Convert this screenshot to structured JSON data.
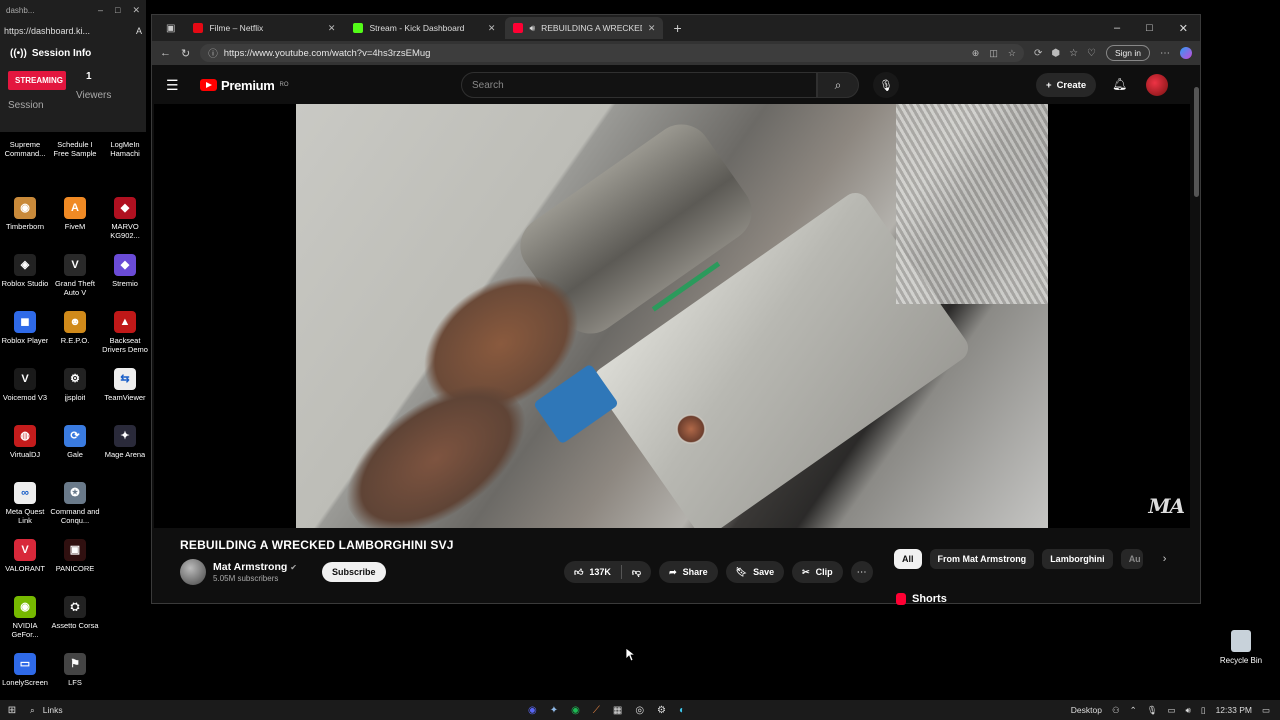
{
  "session_panel": {
    "window_title": "dashb...",
    "url": "https://dashboard.ki...",
    "title": "Session Info",
    "status_badge": "STREAMING",
    "session_label": "Session",
    "viewers_count": "1",
    "viewers_label": "Viewers"
  },
  "desktop_icons": [
    {
      "label": "Supreme Command...",
      "color": "#333"
    },
    {
      "label": "Schedule I Free Sample",
      "color": "#333"
    },
    {
      "label": "LogMeIn Hamachi",
      "color": "#333"
    },
    {
      "label": "Timberborn",
      "color": "#c98a3a",
      "glyph": "◉"
    },
    {
      "label": "FiveM",
      "color": "#f08a24",
      "glyph": "A"
    },
    {
      "label": "MARVO KG902...",
      "color": "#b01020",
      "glyph": "◆"
    },
    {
      "label": "Roblox Studio",
      "color": "#222",
      "glyph": "◈"
    },
    {
      "label": "Grand Theft Auto V",
      "color": "#2a2a2a",
      "glyph": "V"
    },
    {
      "label": "Stremio",
      "color": "#6a4bd6",
      "glyph": "◆"
    },
    {
      "label": "Roblox Player",
      "color": "#2f6ae8",
      "glyph": "◼"
    },
    {
      "label": "R.E.P.O.",
      "color": "#d08a1a",
      "glyph": "☻"
    },
    {
      "label": "Backseat Drivers Demo",
      "color": "#c01818",
      "glyph": "▲"
    },
    {
      "label": "Voicemod V3",
      "color": "#1a1a1a",
      "glyph": "V"
    },
    {
      "label": "jjsploit",
      "color": "#222",
      "glyph": "⚙"
    },
    {
      "label": "TeamViewer",
      "color": "#eeeeee",
      "glyph": "⇆"
    },
    {
      "label": "VirtualDJ",
      "color": "#c41c1c",
      "glyph": "◍"
    },
    {
      "label": "Gale",
      "color": "#3a7be0",
      "glyph": "⟳"
    },
    {
      "label": "Mage Arena",
      "color": "#2a2a3a",
      "glyph": "✦"
    },
    {
      "label": "Meta Quest Link",
      "color": "#eeeeee",
      "glyph": "∞"
    },
    {
      "label": "Command and Conqu...",
      "color": "#6a7a8a",
      "glyph": "✪"
    },
    {
      "label": "",
      "color": "#000",
      "glyph": ""
    },
    {
      "label": "VALORANT",
      "color": "#d8283a",
      "glyph": "V"
    },
    {
      "label": "PANICORE",
      "color": "#301010",
      "glyph": "▣"
    },
    {
      "label": "",
      "color": "#000",
      "glyph": ""
    },
    {
      "label": "NVIDIA GeFor...",
      "color": "#76b900",
      "glyph": "◉"
    },
    {
      "label": "Assetto Corsa",
      "color": "#222",
      "glyph": "⛭"
    },
    {
      "label": "",
      "color": "#000",
      "glyph": ""
    },
    {
      "label": "LonelyScreen",
      "color": "#2f6ae8",
      "glyph": "▭"
    },
    {
      "label": "LFS",
      "color": "#444",
      "glyph": "⚑"
    }
  ],
  "recycle_bin": "Recycle Bin",
  "browser": {
    "tabs": [
      {
        "title": "Filme – Netflix",
        "color": "#e50914",
        "active": false
      },
      {
        "title": "Stream - Kick Dashboard",
        "color": "#53fc18",
        "active": false
      },
      {
        "title": "REBUILDING A WRECKED LA...",
        "color": "#ff0033",
        "active": true
      }
    ],
    "url": "https://www.youtube.com/watch?v=4hs3rzsEMug",
    "sign_in": "Sign in"
  },
  "youtube": {
    "brand": "Premium",
    "region": "RO",
    "search_placeholder": "Search",
    "create_label": "Create",
    "watermark": "MA",
    "video_title": "REBUILDING A WRECKED LAMBORGHINI SVJ",
    "channel_name": "Mat Armstrong",
    "subscribers": "5.05M subscribers",
    "subscribe_label": "Subscribe",
    "likes": "137K",
    "share_label": "Share",
    "save_label": "Save",
    "clip_label": "Clip",
    "chips": [
      "All",
      "From Mat Armstrong",
      "Lamborghini",
      "Au"
    ],
    "shorts_label": "Shorts"
  },
  "taskbar": {
    "search_label": "Links",
    "desktop_label": "Desktop",
    "time": "12:33 PM"
  }
}
